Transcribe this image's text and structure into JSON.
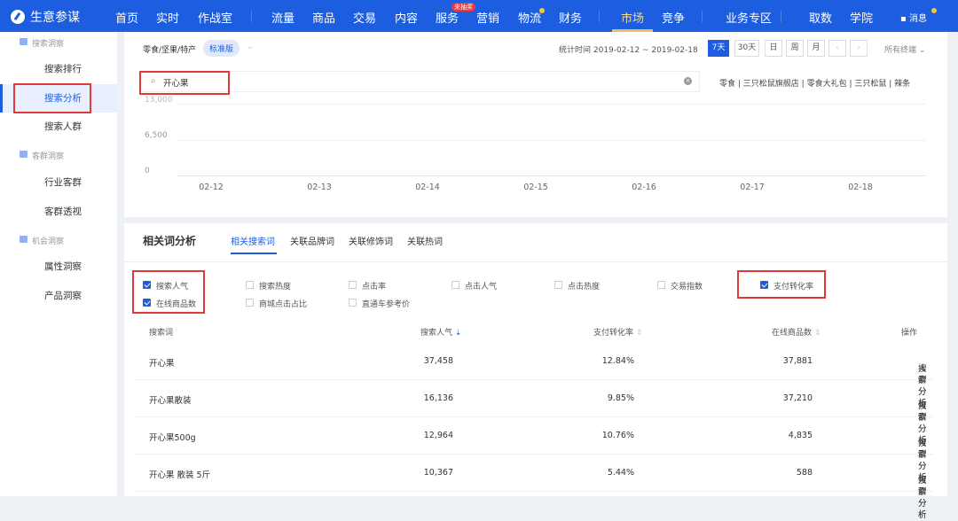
{
  "header": {
    "app_title": "生意参谋",
    "nav": [
      "首页",
      "实时",
      "作战室",
      "流量",
      "商品",
      "交易",
      "内容",
      "服务",
      "营销",
      "物流",
      "财务",
      "市场",
      "竞争",
      "业务专区",
      "取数",
      "学院"
    ],
    "active_nav": "市场",
    "badge": "来抽奖",
    "messages": "消息"
  },
  "sidebar": {
    "sections": [
      {
        "title": "搜索洞察",
        "items": [
          "搜索排行",
          "搜索分析",
          "搜索人群"
        ]
      },
      {
        "title": "客群洞察",
        "items": [
          "行业客群",
          "客群透视"
        ]
      },
      {
        "title": "机会洞察",
        "items": [
          "属性洞察",
          "产品洞察"
        ]
      }
    ],
    "selected": "搜索分析"
  },
  "filter": {
    "category": "零食/坚果/特产",
    "edition": "标准版",
    "stat_time": "统计时间 2019-02-12 ~ 2019-02-18",
    "periods": [
      "7天",
      "30天",
      "日",
      "周",
      "月"
    ],
    "active_period": "7天",
    "terminal": "所有终端"
  },
  "search": {
    "value": "开心果",
    "suggestions": [
      "零食",
      "三只松鼠旗舰店",
      "零食大礼包",
      "三只松鼠",
      "辣条"
    ]
  },
  "chart_data": {
    "type": "line",
    "categories": [
      "02-12",
      "02-13",
      "02-14",
      "02-15",
      "02-16",
      "02-17",
      "02-18"
    ],
    "yticks": [
      "13,000",
      "6,500",
      "0"
    ],
    "ylim": [
      0,
      13000
    ],
    "series": []
  },
  "related": {
    "title": "相关词分析",
    "tabs": [
      "相关搜索词",
      "关联品牌词",
      "关联修饰词",
      "关联热词"
    ],
    "active_tab": "相关搜索词",
    "metrics": [
      {
        "label": "搜索人气",
        "checked": true
      },
      {
        "label": "搜索热度",
        "checked": false
      },
      {
        "label": "点击率",
        "checked": false
      },
      {
        "label": "点击人气",
        "checked": false
      },
      {
        "label": "点击热度",
        "checked": false
      },
      {
        "label": "交易指数",
        "checked": false
      },
      {
        "label": "支付转化率",
        "checked": true
      },
      {
        "label": "在线商品数",
        "checked": true
      },
      {
        "label": "商城点击占比",
        "checked": false
      },
      {
        "label": "直通车参考价",
        "checked": false
      }
    ],
    "columns": [
      "搜索词",
      "搜索人气",
      "支付转化率",
      "在线商品数",
      "操作"
    ],
    "rows": [
      {
        "word": "开心果",
        "pop": "37,458",
        "conv": "12.84%",
        "items": "37,881"
      },
      {
        "word": "开心果散装",
        "pop": "16,136",
        "conv": "9.85%",
        "items": "37,210"
      },
      {
        "word": "开心果500g",
        "pop": "12,964",
        "conv": "10.76%",
        "items": "4,835"
      },
      {
        "word": "开心果 散装 5斤",
        "pop": "10,367",
        "conv": "5.44%",
        "items": "588"
      }
    ],
    "actions": [
      "搜索分析",
      "人群分析"
    ]
  }
}
